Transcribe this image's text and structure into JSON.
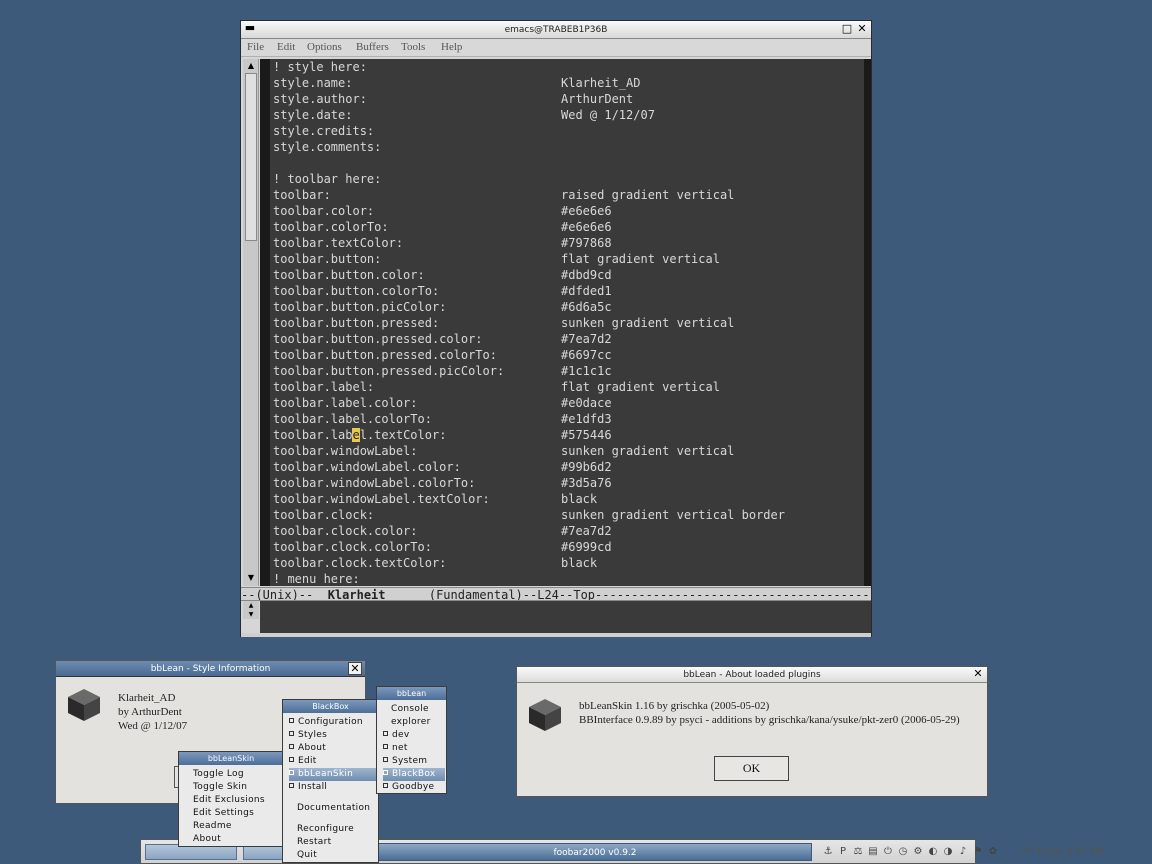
{
  "emacs": {
    "title": "emacs@TRABEB1P36B",
    "menu": [
      "File",
      "Edit",
      "Options",
      "Buffers",
      "Tools",
      "Help"
    ],
    "lines": [
      {
        "k": "! style here:",
        "v": ""
      },
      {
        "k": "style.name:",
        "v": "Klarheit_AD"
      },
      {
        "k": "style.author:",
        "v": "ArthurDent"
      },
      {
        "k": "style.date:",
        "v": "Wed @ 1/12/07"
      },
      {
        "k": "style.credits:",
        "v": ""
      },
      {
        "k": "style.comments:",
        "v": ""
      },
      {
        "k": "",
        "v": ""
      },
      {
        "k": "! toolbar here:",
        "v": ""
      },
      {
        "k": "toolbar:",
        "v": "raised gradient vertical"
      },
      {
        "k": "toolbar.color:",
        "v": "#e6e6e6"
      },
      {
        "k": "toolbar.colorTo:",
        "v": "#e6e6e6"
      },
      {
        "k": "toolbar.textColor:",
        "v": "#797868"
      },
      {
        "k": "toolbar.button:",
        "v": "flat gradient vertical"
      },
      {
        "k": "toolbar.button.color:",
        "v": "#dbd9cd"
      },
      {
        "k": "toolbar.button.colorTo:",
        "v": "#dfded1"
      },
      {
        "k": "toolbar.button.picColor:",
        "v": "#6d6a5c"
      },
      {
        "k": "toolbar.button.pressed:",
        "v": "sunken gradient vertical"
      },
      {
        "k": "toolbar.button.pressed.color:",
        "v": "#7ea7d2"
      },
      {
        "k": "toolbar.button.pressed.colorTo:",
        "v": "#6697cc"
      },
      {
        "k": "toolbar.button.pressed.picColor:",
        "v": "#1c1c1c"
      },
      {
        "k": "toolbar.label:",
        "v": "flat gradient vertical"
      },
      {
        "k": "toolbar.label.color:",
        "v": "#e0dace"
      },
      {
        "k": "toolbar.label.colorTo:",
        "v": "#e1dfd3"
      },
      {
        "k": "toolbar.label.textColor:",
        "v": "#575446"
      },
      {
        "k": "toolbar.windowLabel:",
        "v": "sunken gradient vertical"
      },
      {
        "k": "toolbar.windowLabel.color:",
        "v": "#99b6d2"
      },
      {
        "k": "toolbar.windowLabel.colorTo:",
        "v": "#3d5a76"
      },
      {
        "k": "toolbar.windowLabel.textColor:",
        "v": "black"
      },
      {
        "k": "toolbar.clock:",
        "v": "sunken gradient vertical border"
      },
      {
        "k": "toolbar.clock.color:",
        "v": "#7ea7d2"
      },
      {
        "k": "toolbar.clock.colorTo:",
        "v": "#6999cd"
      },
      {
        "k": "toolbar.clock.textColor:",
        "v": "black"
      },
      {
        "k": "! menu here:",
        "v": ""
      }
    ],
    "cursor_line": {
      "pre": "toolbar.lab",
      "ch": "e",
      "post": "l.textColor:"
    },
    "modeline": {
      "prefix": "--(Unix)--  ",
      "buffer": "Klarheit",
      "rest": "      (Fundamental)--L24--Top-----------------------------------------"
    }
  },
  "style_info": {
    "title": "bbLean - Style Information",
    "name": "Klarheit_AD",
    "author": "by ArthurDent",
    "date": "Wed @ 1/12/07"
  },
  "about": {
    "title": "bbLean - About loaded plugins",
    "line1": "bbLeanSkin 1.16 by grischka (2005-05-02)",
    "line2": "BBInterface 0.9.89 by psyci - additions by grischka/kana/ysuke/pkt-zer0 (2006-05-29)",
    "ok": "OK"
  },
  "menu_bbleanskin": {
    "title": "bbLeanSkin",
    "items": [
      "Toggle Log",
      "Toggle Skin",
      "Edit Exclusions",
      "Edit Settings",
      "Readme",
      "About"
    ]
  },
  "menu_blackbox": {
    "title": "BlackBox",
    "items": [
      "Configuration",
      "Styles",
      "About",
      "Edit",
      "bbLeanSkin",
      "Install"
    ],
    "documentation": "Documentation",
    "reconfigure": "Reconfigure",
    "restart": "Restart",
    "quit": "Quit"
  },
  "menu_bblean": {
    "title": "bbLean",
    "console": "Console",
    "explorer": "explorer",
    "items": [
      "dev",
      "net",
      "System",
      "BlackBox",
      "Goodbye"
    ]
  },
  "toolbar": {
    "label": "foobar2000 v0.9.2",
    "clock": "Fri 12 Jan 2:27 PM",
    "tray_icons": [
      "tray-icon",
      "tray-icon",
      "tray-icon",
      "tray-icon",
      "tray-icon",
      "tray-icon",
      "tray-icon",
      "tray-icon",
      "tray-icon",
      "tray-icon",
      "tray-icon",
      "tray-icon"
    ]
  },
  "colors": {
    "desktop": "#3d5a7a",
    "emacs_bg": "#3a3a3a",
    "titlebar": "#4a6a93"
  }
}
